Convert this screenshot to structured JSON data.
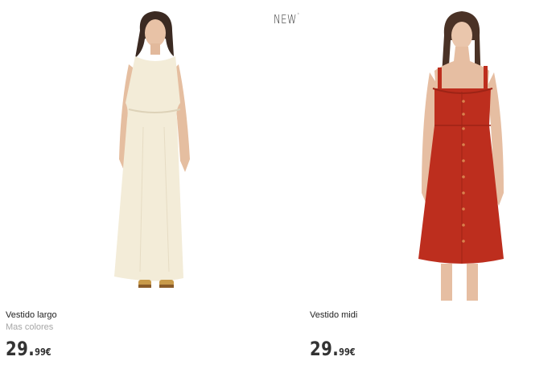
{
  "badge": {
    "text": "NEW",
    "mark": "*"
  },
  "products": [
    {
      "name": "Vestido largo",
      "subtitle": "Mas colores",
      "price_integer": "29.",
      "price_decimal": "99€",
      "image": "cream-sleeveless-maxi-dress-photo",
      "dress_color": "#f3ecd8"
    },
    {
      "name": "Vestido midi",
      "price_integer": "29.",
      "price_decimal": "99€",
      "image": "red-button-front-midi-dress-photo",
      "dress_color": "#bd2e1e"
    }
  ]
}
